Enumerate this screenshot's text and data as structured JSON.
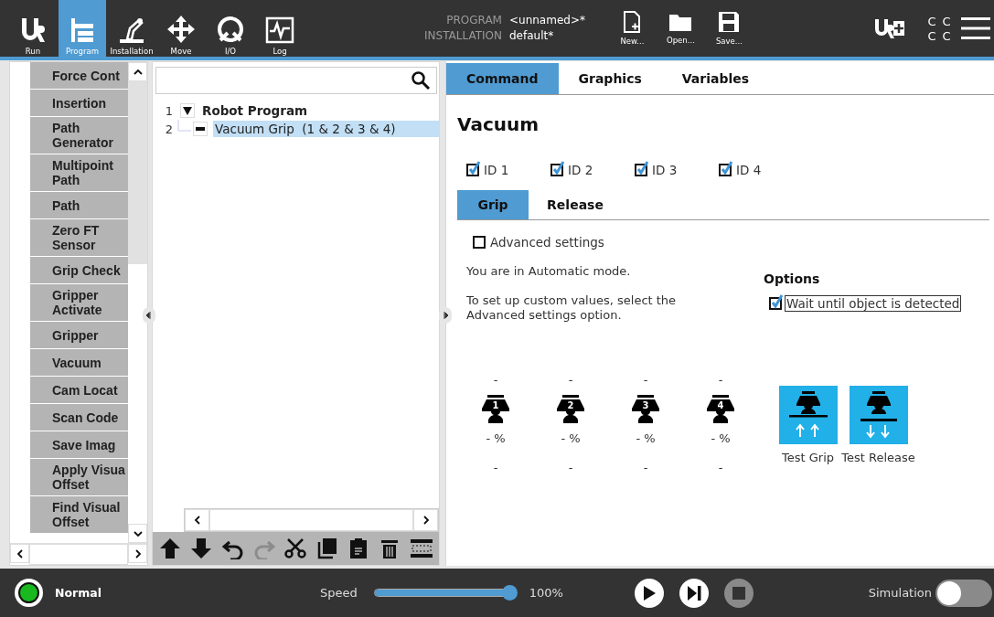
{
  "top_bar": {
    "nav": [
      {
        "label": "Run",
        "kind": "run",
        "selected": false
      },
      {
        "label": "Program",
        "kind": "program",
        "selected": true
      },
      {
        "label": "Installation",
        "kind": "installation",
        "selected": false
      },
      {
        "label": "Move",
        "kind": "move",
        "selected": false
      },
      {
        "label": "I/O",
        "kind": "io",
        "selected": false
      },
      {
        "label": "Log",
        "kind": "log",
        "selected": false
      }
    ],
    "program": {
      "label": "PROGRAM",
      "value": "<unnamed>*"
    },
    "installation": {
      "label": "INSTALLATION",
      "value": "default*"
    },
    "file_buttons": [
      {
        "label": "New...",
        "kind": "new"
      },
      {
        "label": "Open...",
        "kind": "open"
      },
      {
        "label": "Save...",
        "kind": "save"
      }
    ],
    "status_letters": [
      "C",
      "C",
      "C",
      "C"
    ]
  },
  "palette": {
    "items": [
      "Force Cont",
      "Insertion",
      "Path Generator",
      "Multipoint Path",
      "Path",
      "Zero FT Sensor",
      "Grip Check",
      "Gripper Activate",
      "Gripper",
      "Vacuum",
      "Cam Locat",
      "Scan Code",
      "Save Imag",
      "Apply Visua Offset",
      "Find Visual Offset"
    ]
  },
  "tree": {
    "nodes": [
      {
        "line": "1",
        "label": "Robot Program",
        "expanded": true,
        "selected": false,
        "children": [
          {
            "line": "2",
            "label": "Vacuum Grip  (1 & 2 & 3 & 4)",
            "selected": true
          }
        ]
      }
    ],
    "tools": [
      {
        "kind": "up",
        "disabled": false
      },
      {
        "kind": "down",
        "disabled": false
      },
      {
        "kind": "undo",
        "disabled": false
      },
      {
        "kind": "redo",
        "disabled": true
      },
      {
        "kind": "cut",
        "disabled": false
      },
      {
        "kind": "copy",
        "disabled": false
      },
      {
        "kind": "paste",
        "disabled": false
      },
      {
        "kind": "delete",
        "disabled": false
      },
      {
        "kind": "suppress",
        "disabled": false
      }
    ]
  },
  "tabs": [
    {
      "label": "Command",
      "selected": true
    },
    {
      "label": "Graphics",
      "selected": false
    },
    {
      "label": "Variables",
      "selected": false
    }
  ],
  "command": {
    "title": "Vacuum",
    "ids": [
      {
        "label": "ID 1",
        "checked": true
      },
      {
        "label": "ID 2",
        "checked": true
      },
      {
        "label": "ID 3",
        "checked": true
      },
      {
        "label": "ID 4",
        "checked": true
      }
    ],
    "subtabs": [
      {
        "label": "Grip",
        "selected": true
      },
      {
        "label": "Release",
        "selected": false
      }
    ],
    "advanced": {
      "label": "Advanced settings",
      "checked": false
    },
    "mode_text": "You are in Automatic mode.",
    "help_text": "To set up custom values, select the Advanced settings option.",
    "options": {
      "title": "Options",
      "items": [
        {
          "label": "Wait until object is detected",
          "checked": true
        }
      ]
    },
    "cups": [
      {
        "top": "-",
        "number": "1",
        "reading": "- %",
        "bottom": "-"
      },
      {
        "top": "-",
        "number": "2",
        "reading": "- %",
        "bottom": "-"
      },
      {
        "top": "-",
        "number": "3",
        "reading": "- %",
        "bottom": "-"
      },
      {
        "top": "-",
        "number": "4",
        "reading": "- %",
        "bottom": "-"
      }
    ],
    "tests": [
      {
        "label": "Test Grip",
        "kind": "grip"
      },
      {
        "label": "Test Release",
        "kind": "release"
      }
    ]
  },
  "bottom_bar": {
    "status": {
      "label": "Normal",
      "color": "#19b81e"
    },
    "speed": {
      "label": "Speed",
      "level": 1,
      "reading": "100%"
    },
    "controls": [
      {
        "kind": "play",
        "disabled": false
      },
      {
        "kind": "step",
        "disabled": false
      },
      {
        "kind": "stop",
        "disabled": true
      }
    ],
    "simulation": {
      "label": "Simulation",
      "on": false
    }
  }
}
